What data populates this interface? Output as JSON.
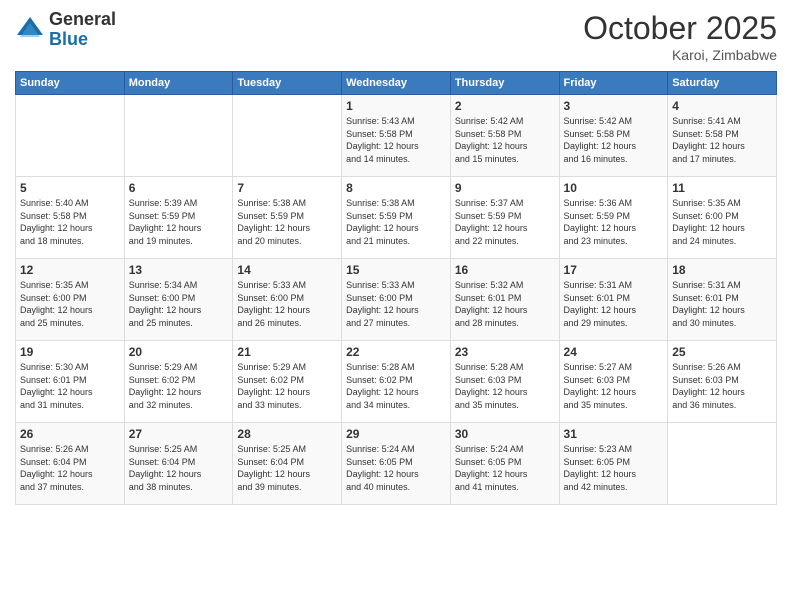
{
  "logo": {
    "general": "General",
    "blue": "Blue"
  },
  "title": "October 2025",
  "location": "Karoi, Zimbabwe",
  "days_of_week": [
    "Sunday",
    "Monday",
    "Tuesday",
    "Wednesday",
    "Thursday",
    "Friday",
    "Saturday"
  ],
  "weeks": [
    [
      {
        "day": "",
        "info": ""
      },
      {
        "day": "",
        "info": ""
      },
      {
        "day": "",
        "info": ""
      },
      {
        "day": "1",
        "info": "Sunrise: 5:43 AM\nSunset: 5:58 PM\nDaylight: 12 hours\nand 14 minutes."
      },
      {
        "day": "2",
        "info": "Sunrise: 5:42 AM\nSunset: 5:58 PM\nDaylight: 12 hours\nand 15 minutes."
      },
      {
        "day": "3",
        "info": "Sunrise: 5:42 AM\nSunset: 5:58 PM\nDaylight: 12 hours\nand 16 minutes."
      },
      {
        "day": "4",
        "info": "Sunrise: 5:41 AM\nSunset: 5:58 PM\nDaylight: 12 hours\nand 17 minutes."
      }
    ],
    [
      {
        "day": "5",
        "info": "Sunrise: 5:40 AM\nSunset: 5:58 PM\nDaylight: 12 hours\nand 18 minutes."
      },
      {
        "day": "6",
        "info": "Sunrise: 5:39 AM\nSunset: 5:59 PM\nDaylight: 12 hours\nand 19 minutes."
      },
      {
        "day": "7",
        "info": "Sunrise: 5:38 AM\nSunset: 5:59 PM\nDaylight: 12 hours\nand 20 minutes."
      },
      {
        "day": "8",
        "info": "Sunrise: 5:38 AM\nSunset: 5:59 PM\nDaylight: 12 hours\nand 21 minutes."
      },
      {
        "day": "9",
        "info": "Sunrise: 5:37 AM\nSunset: 5:59 PM\nDaylight: 12 hours\nand 22 minutes."
      },
      {
        "day": "10",
        "info": "Sunrise: 5:36 AM\nSunset: 5:59 PM\nDaylight: 12 hours\nand 23 minutes."
      },
      {
        "day": "11",
        "info": "Sunrise: 5:35 AM\nSunset: 6:00 PM\nDaylight: 12 hours\nand 24 minutes."
      }
    ],
    [
      {
        "day": "12",
        "info": "Sunrise: 5:35 AM\nSunset: 6:00 PM\nDaylight: 12 hours\nand 25 minutes."
      },
      {
        "day": "13",
        "info": "Sunrise: 5:34 AM\nSunset: 6:00 PM\nDaylight: 12 hours\nand 25 minutes."
      },
      {
        "day": "14",
        "info": "Sunrise: 5:33 AM\nSunset: 6:00 PM\nDaylight: 12 hours\nand 26 minutes."
      },
      {
        "day": "15",
        "info": "Sunrise: 5:33 AM\nSunset: 6:00 PM\nDaylight: 12 hours\nand 27 minutes."
      },
      {
        "day": "16",
        "info": "Sunrise: 5:32 AM\nSunset: 6:01 PM\nDaylight: 12 hours\nand 28 minutes."
      },
      {
        "day": "17",
        "info": "Sunrise: 5:31 AM\nSunset: 6:01 PM\nDaylight: 12 hours\nand 29 minutes."
      },
      {
        "day": "18",
        "info": "Sunrise: 5:31 AM\nSunset: 6:01 PM\nDaylight: 12 hours\nand 30 minutes."
      }
    ],
    [
      {
        "day": "19",
        "info": "Sunrise: 5:30 AM\nSunset: 6:01 PM\nDaylight: 12 hours\nand 31 minutes."
      },
      {
        "day": "20",
        "info": "Sunrise: 5:29 AM\nSunset: 6:02 PM\nDaylight: 12 hours\nand 32 minutes."
      },
      {
        "day": "21",
        "info": "Sunrise: 5:29 AM\nSunset: 6:02 PM\nDaylight: 12 hours\nand 33 minutes."
      },
      {
        "day": "22",
        "info": "Sunrise: 5:28 AM\nSunset: 6:02 PM\nDaylight: 12 hours\nand 34 minutes."
      },
      {
        "day": "23",
        "info": "Sunrise: 5:28 AM\nSunset: 6:03 PM\nDaylight: 12 hours\nand 35 minutes."
      },
      {
        "day": "24",
        "info": "Sunrise: 5:27 AM\nSunset: 6:03 PM\nDaylight: 12 hours\nand 35 minutes."
      },
      {
        "day": "25",
        "info": "Sunrise: 5:26 AM\nSunset: 6:03 PM\nDaylight: 12 hours\nand 36 minutes."
      }
    ],
    [
      {
        "day": "26",
        "info": "Sunrise: 5:26 AM\nSunset: 6:04 PM\nDaylight: 12 hours\nand 37 minutes."
      },
      {
        "day": "27",
        "info": "Sunrise: 5:25 AM\nSunset: 6:04 PM\nDaylight: 12 hours\nand 38 minutes."
      },
      {
        "day": "28",
        "info": "Sunrise: 5:25 AM\nSunset: 6:04 PM\nDaylight: 12 hours\nand 39 minutes."
      },
      {
        "day": "29",
        "info": "Sunrise: 5:24 AM\nSunset: 6:05 PM\nDaylight: 12 hours\nand 40 minutes."
      },
      {
        "day": "30",
        "info": "Sunrise: 5:24 AM\nSunset: 6:05 PM\nDaylight: 12 hours\nand 41 minutes."
      },
      {
        "day": "31",
        "info": "Sunrise: 5:23 AM\nSunset: 6:05 PM\nDaylight: 12 hours\nand 42 minutes."
      },
      {
        "day": "",
        "info": ""
      }
    ]
  ]
}
